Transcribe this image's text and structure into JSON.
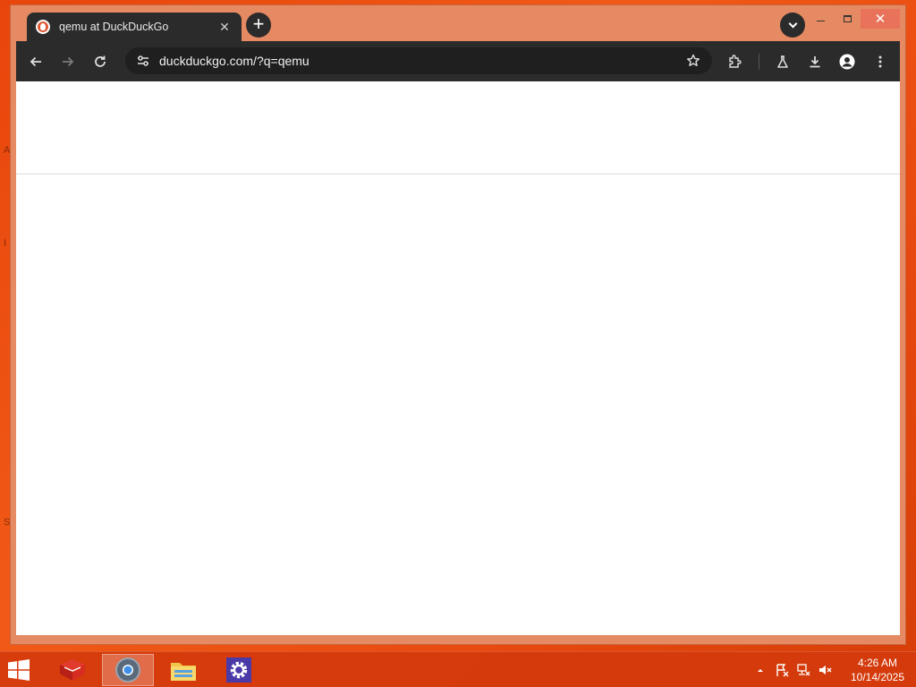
{
  "browser": {
    "tab": {
      "title": "qemu at DuckDuckGo",
      "close_label": "✕"
    },
    "new_tab_label": "+",
    "window_controls": {
      "close_label": "✕"
    },
    "omnibox": {
      "url": "duckduckgo.com/?q=qemu"
    },
    "icons": [
      "duckduckgo-favicon",
      "back-icon",
      "forward-icon",
      "reload-icon",
      "site-info-icon",
      "star-icon",
      "extensions-icon",
      "labs-icon",
      "download-icon",
      "profile-icon",
      "menu-icon"
    ],
    "colors": {
      "frame": "#e58a62",
      "toolbar": "#2b2b2b",
      "omnibox": "#1f1f1f",
      "page": "#ffffff"
    }
  },
  "desktop": {
    "edge_glyphs": [
      "A",
      "I",
      "S"
    ]
  },
  "taskbar": {
    "apps": [
      {
        "name": "app-one",
        "active": false
      },
      {
        "name": "chrome",
        "active": true
      },
      {
        "name": "file-explorer",
        "active": false
      },
      {
        "name": "settings",
        "active": false
      }
    ],
    "clock": {
      "time": "4:26 AM",
      "date": "10/14/2025"
    },
    "tray_icons": [
      "show-hidden-icons",
      "action-center-flag-icon",
      "network-icon",
      "volume-muted-icon"
    ],
    "colors": {
      "taskbar": "#d43a0c",
      "desktop": "#e8450c"
    }
  }
}
